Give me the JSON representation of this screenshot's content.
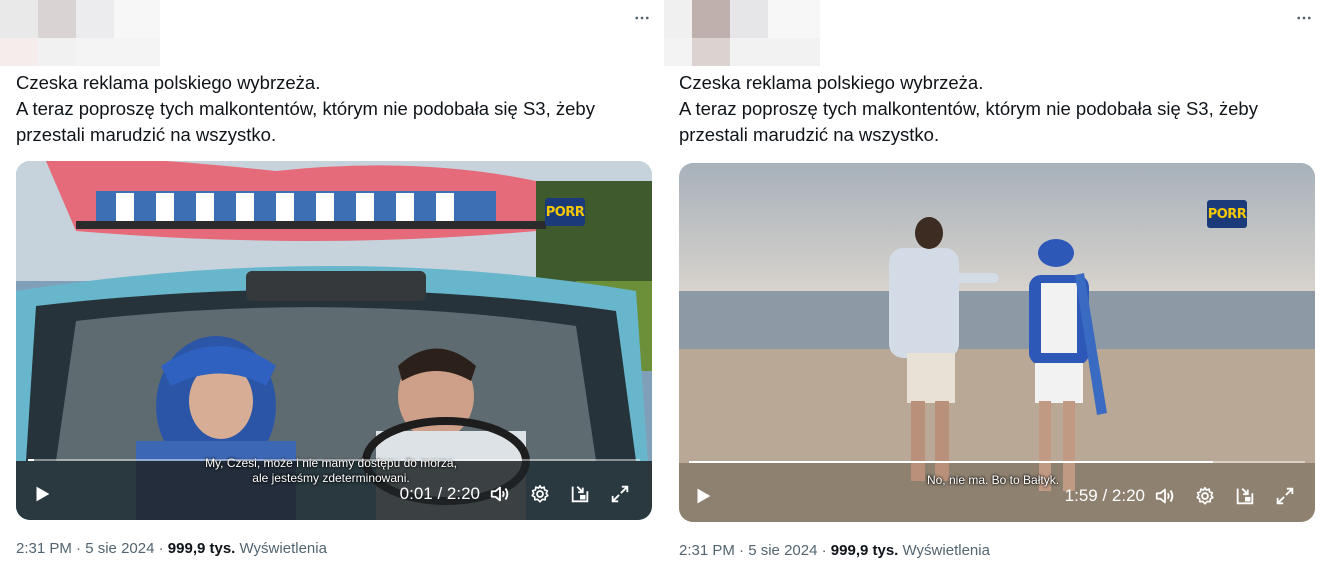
{
  "tweets": [
    {
      "text_lines": [
        "Czeska reklama polskiego wybrzeża.",
        "A teraz poproszę tych malkontentów, którym nie podobała się S3, żeby",
        "przestali marudzić na wszystko."
      ],
      "more_icon": "more-horizontal-icon",
      "video": {
        "logo": "PORR",
        "subtitle_lines": [
          "My, Czesi, może i nie mamy dostępu do morza,",
          "ale jesteśmy zdeterminowani."
        ],
        "time": "0:01 / 2:20",
        "progress": 0.01
      },
      "time": "2:31 PM",
      "date": "5 sie 2024",
      "views": "999,9 tys.",
      "views_label": "Wyświetlenia",
      "separator": "·"
    },
    {
      "text_lines": [
        "Czeska reklama polskiego wybrzeża.",
        "A teraz poproszę tych malkontentów, którym nie podobała się S3, żeby",
        "przestali marudzić na wszystko."
      ],
      "more_icon": "more-horizontal-icon",
      "video": {
        "logo": "PORR",
        "subtitle_lines": [
          "No, nie ma. Bo to Bałtyk."
        ],
        "time": "1:59 / 2:20",
        "progress": 0.85
      },
      "time": "2:31 PM",
      "date": "5 sie 2024",
      "views": "999,9 tys.",
      "views_label": "Wyświetlenia",
      "separator": "·"
    }
  ],
  "icons": {
    "play": "play-icon",
    "volume": "volume-icon",
    "settings": "settings-gear-icon",
    "dock": "picture-in-picture-icon",
    "fullscreen": "fullscreen-icon"
  }
}
